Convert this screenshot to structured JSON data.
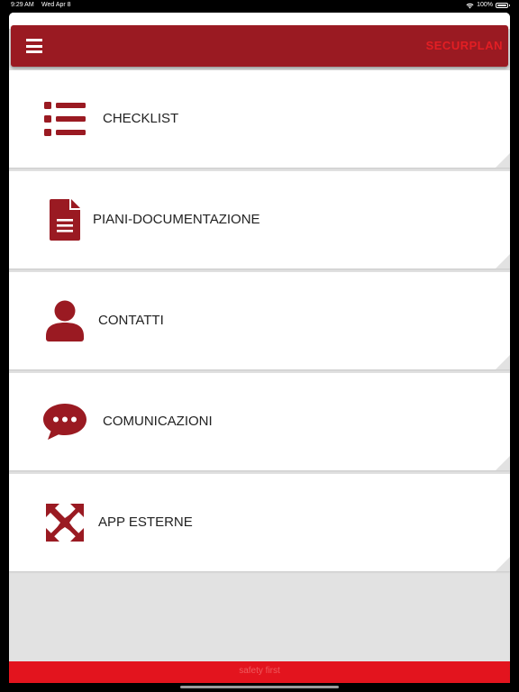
{
  "status": {
    "time": "9:29 AM",
    "date": "Wed Apr 8",
    "battery": "100%"
  },
  "header": {
    "menu_icon": "hamburger-icon",
    "brand": "SECURPLAN"
  },
  "menu": {
    "items": [
      {
        "label": "CHECKLIST",
        "icon": "list-icon"
      },
      {
        "label": "PIANI-DOCUMENTAZIONE",
        "icon": "document-icon"
      },
      {
        "label": "CONTATTI",
        "icon": "person-icon"
      },
      {
        "label": "COMUNICAZIONI",
        "icon": "chat-bubble-icon"
      },
      {
        "label": "APP ESTERNE",
        "icon": "expand-arrows-icon"
      }
    ]
  },
  "footer": {
    "text": "safety first"
  },
  "colors": {
    "header_bg": "#9a1a22",
    "icon": "#9a1a22",
    "brand": "#e31e24",
    "footer_bg": "#e3141e"
  }
}
